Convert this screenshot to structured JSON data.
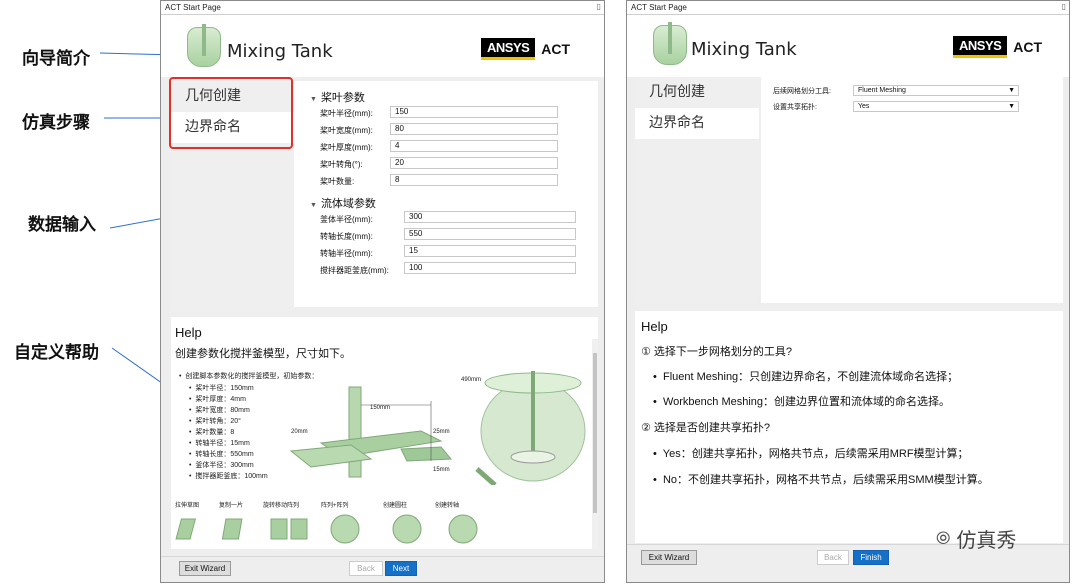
{
  "annotations": [
    "向导简介",
    "仿真步骤",
    "数据输入",
    "自定义帮助"
  ],
  "colors": {
    "accent_blue": "#1570c8",
    "annotation_red": "#e0302a",
    "arrow_blue": "#2f6fd0",
    "tank_green": "#a9d1a0"
  },
  "left_window": {
    "title": "ACT Start Page",
    "app_title": "Mixing Tank",
    "logo_brand": "ANSYS",
    "logo_suffix": "ACT",
    "steps": [
      "几何创建",
      "边界命名"
    ],
    "section1": {
      "title": "桨叶参数",
      "fields": [
        {
          "label": "桨叶半径(mm):",
          "value": "150"
        },
        {
          "label": "桨叶宽度(mm):",
          "value": "80"
        },
        {
          "label": "桨叶厚度(mm):",
          "value": "4"
        },
        {
          "label": "桨叶转角(°):",
          "value": "20"
        },
        {
          "label": "桨叶数量:",
          "value": "8"
        }
      ]
    },
    "section2": {
      "title": "流体域参数",
      "fields": [
        {
          "label": "釜体半径(mm):",
          "value": "300"
        },
        {
          "label": "转轴长度(mm):",
          "value": "550"
        },
        {
          "label": "转轴半径(mm):",
          "value": "15"
        },
        {
          "label": "搅拌器距釜底(mm):",
          "value": "100"
        }
      ]
    },
    "help": {
      "title": "Help",
      "subtitle": "创建参数化搅拌釜模型，尺寸如下。",
      "intro": "创建脚本参数化的搅拌釜模型，初始参数：",
      "bullets": [
        "桨叶半径：150mm",
        "桨叶厚度：4mm",
        "桨叶宽度：80mm",
        "桨叶转角：20°",
        "桨叶数量：8",
        "转轴半径：15mm",
        "转轴长度：550mm",
        "釜体半径：300mm",
        "搅拌器距釜底：100mm"
      ],
      "dims": [
        "150mm",
        "20mm",
        "25mm",
        "15mm",
        "490mm"
      ],
      "steps_row": [
        "拉伸草图",
        "复制一片",
        "旋转移动阵列",
        "阵列+阵列",
        "创建圆柱",
        "创建转轴"
      ]
    },
    "buttons": {
      "exit": "Exit Wizard",
      "back": "Back",
      "next": "Next"
    }
  },
  "right_window": {
    "title": "ACT Start Page",
    "app_title": "Mixing Tank",
    "logo_brand": "ANSYS",
    "logo_suffix": "ACT",
    "steps": [
      "几何创建",
      "边界命名"
    ],
    "fields": [
      {
        "label": "后续网格划分工具:",
        "value": "Fluent Meshing"
      },
      {
        "label": "设置共享拓扑:",
        "value": "Yes"
      }
    ],
    "help": {
      "title": "Help",
      "q1": "① 选择下一步网格划分的工具?",
      "q1_items": [
        "Fluent Meshing：只创建边界命名，不创建流体域命名选择；",
        "Workbench Meshing：创建边界位置和流体域的命名选择。"
      ],
      "q2": "② 选择是否创建共享拓扑?",
      "q2_items": [
        "Yes：创建共享拓扑，网格共节点，后续需采用MRF模型计算；",
        "No：不创建共享拓扑，网格不共节点，后续需采用SMM模型计算。"
      ]
    },
    "buttons": {
      "exit": "Exit Wizard",
      "back": "Back",
      "finish": "Finish"
    }
  },
  "watermark": "仿真秀"
}
